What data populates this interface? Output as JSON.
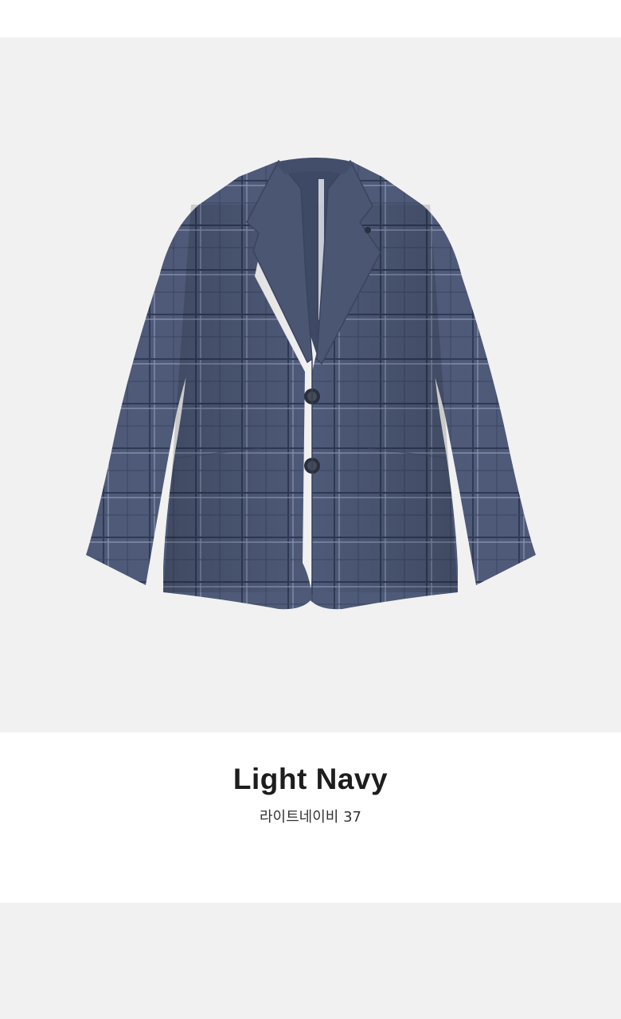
{
  "caption": {
    "color_name": "Light Navy",
    "color_subtitle": "라이트네이비 37"
  },
  "colors": {
    "photo_background": "#f1f1f1",
    "jacket_fabric": "#4e5b78",
    "check_pattern_light": "#8e9ab8",
    "check_pattern_dark": "#2c3650",
    "page_background": "#ffffff",
    "title_text": "#1d1d1d"
  },
  "image": {
    "subject": "jacket"
  }
}
